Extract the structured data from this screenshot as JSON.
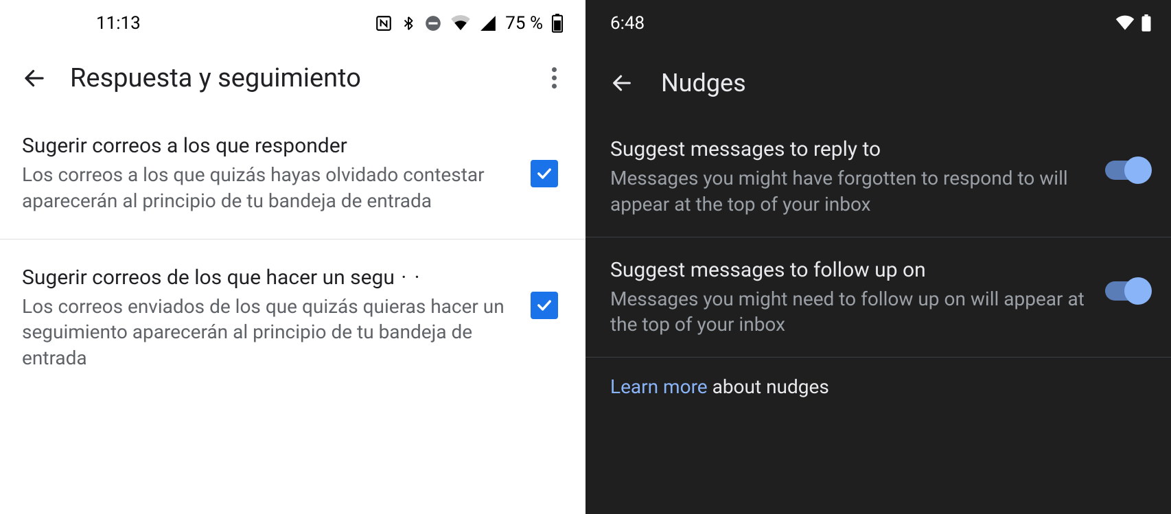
{
  "left": {
    "status": {
      "time": "11:13",
      "battery_pct": "75 %"
    },
    "appbar": {
      "title": "Respuesta y seguimiento"
    },
    "items": [
      {
        "title": "Sugerir correos a los que responder",
        "desc": "Los correos a los que quizás hayas olvidado contestar aparecerán al principio de tu bandeja de entrada",
        "checked": true
      },
      {
        "title": "Sugerir correos de los que hacer un segu",
        "desc": "Los correos enviados de los que quizás quieras hacer un seguimiento aparecerán al principio de tu bandeja de entrada",
        "checked": true
      }
    ]
  },
  "right": {
    "status": {
      "time": "6:48"
    },
    "appbar": {
      "title": "Nudges"
    },
    "items": [
      {
        "title": "Suggest messages to reply to",
        "desc": "Messages you might have forgotten to respond to will appear at the top of your inbox",
        "on": true
      },
      {
        "title": "Suggest messages to follow up on",
        "desc": "Messages you might need to follow up on will appear at the top of your inbox",
        "on": true
      }
    ],
    "footer": {
      "link": "Learn more",
      "rest": " about nudges"
    }
  }
}
